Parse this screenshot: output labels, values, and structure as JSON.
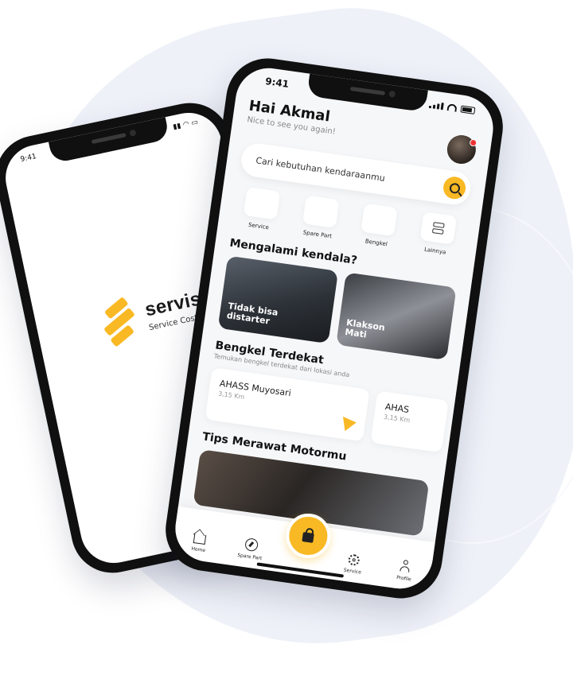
{
  "colors": {
    "accent": "#f9b924",
    "background": "#eef1f8",
    "text": "#121212"
  },
  "splash": {
    "status_time": "9:41",
    "brand_name": "servismo",
    "brand_tagline": "Service Cost Es"
  },
  "home": {
    "status_time": "9:41",
    "greeting": "Hai Akmal",
    "sub_greeting": "Nice to see you again!",
    "search_placeholder": "Cari kebutuhan kendaraanmu",
    "categories": [
      {
        "label": "Service",
        "icon": "service-icon"
      },
      {
        "label": "Spare Part",
        "icon": "spare-part-icon"
      },
      {
        "label": "Bengkel",
        "icon": "bengkel-icon"
      },
      {
        "label": "Lainnya",
        "icon": "menu-icon"
      }
    ],
    "problems_title": "Mengalami kendala?",
    "problems": [
      {
        "label": "Tidak bisa distarter"
      },
      {
        "label": "Klakson Mati"
      }
    ],
    "bengkel_title": "Bengkel Terdekat",
    "bengkel_subtitle": "Temukan bengkel terdekat dari lokasi anda",
    "bengkel": [
      {
        "name": "AHASS Muyosari",
        "distance": "3,15 Km"
      },
      {
        "name": "AHAS",
        "distance": "3,15 Km"
      }
    ],
    "tips_title": "Tips Merawat Motormu",
    "nav": {
      "home": "Home",
      "spare_part": "Spare Part",
      "service": "Service",
      "profile": "Profile"
    }
  }
}
